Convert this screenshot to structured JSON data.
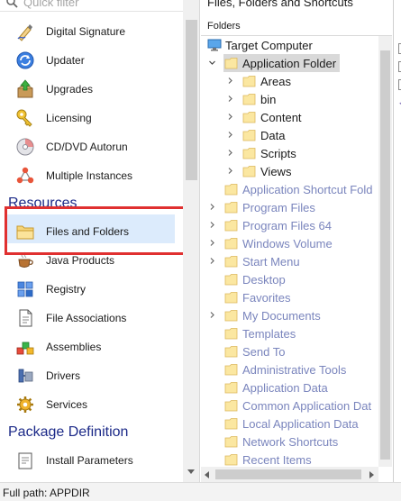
{
  "filter": {
    "placeholder": "Quick filter"
  },
  "nav": {
    "group1_items": [
      {
        "label": "Digital Signature",
        "icon": "signature-icon"
      },
      {
        "label": "Updater",
        "icon": "updater-icon"
      },
      {
        "label": "Upgrades",
        "icon": "upgrades-icon"
      },
      {
        "label": "Licensing",
        "icon": "key-icon"
      },
      {
        "label": "CD/DVD Autorun",
        "icon": "disc-icon"
      },
      {
        "label": "Multiple Instances",
        "icon": "instances-icon"
      }
    ],
    "resources_header": "Resources",
    "resources_items": [
      {
        "label": "Files and Folders",
        "icon": "folder-icon",
        "selected": true
      },
      {
        "label": "Java Products",
        "icon": "java-icon"
      },
      {
        "label": "Registry",
        "icon": "registry-icon"
      },
      {
        "label": "File Associations",
        "icon": "file-association-icon"
      },
      {
        "label": "Assemblies",
        "icon": "assemblies-icon"
      },
      {
        "label": "Drivers",
        "icon": "drivers-icon"
      },
      {
        "label": "Services",
        "icon": "services-icon"
      }
    ],
    "package_header": "Package Definition",
    "package_items": [
      {
        "label": "Install Parameters",
        "icon": "install-parameters-icon"
      }
    ]
  },
  "center": {
    "title": "Files, Folders and Shortcuts",
    "tree_header": "Folders",
    "tree": [
      {
        "label": "Target Computer",
        "icon": "computer",
        "expander": "none",
        "depth": 0,
        "dim": false
      },
      {
        "label": "Application Folder",
        "icon": "folder",
        "expander": "open",
        "depth": 1,
        "dim": false,
        "selected": true
      },
      {
        "label": "Areas",
        "icon": "folder",
        "expander": "closed",
        "depth": 2,
        "dim": false
      },
      {
        "label": "bin",
        "icon": "folder",
        "expander": "closed",
        "depth": 2,
        "dim": false
      },
      {
        "label": "Content",
        "icon": "folder",
        "expander": "closed",
        "depth": 2,
        "dim": false
      },
      {
        "label": "Data",
        "icon": "folder",
        "expander": "closed",
        "depth": 2,
        "dim": false
      },
      {
        "label": "Scripts",
        "icon": "folder",
        "expander": "closed",
        "depth": 2,
        "dim": false
      },
      {
        "label": "Views",
        "icon": "folder",
        "expander": "closed",
        "depth": 2,
        "dim": false
      },
      {
        "label": "Application Shortcut Fold",
        "icon": "folder",
        "expander": "none",
        "depth": 1,
        "dim": true
      },
      {
        "label": "Program Files",
        "icon": "folder",
        "expander": "closed",
        "depth": 1,
        "dim": true
      },
      {
        "label": "Program Files 64",
        "icon": "folder",
        "expander": "closed",
        "depth": 1,
        "dim": true
      },
      {
        "label": "Windows Volume",
        "icon": "folder",
        "expander": "closed",
        "depth": 1,
        "dim": true
      },
      {
        "label": "Start Menu",
        "icon": "folder",
        "expander": "closed",
        "depth": 1,
        "dim": true
      },
      {
        "label": "Desktop",
        "icon": "folder",
        "expander": "none",
        "depth": 1,
        "dim": true
      },
      {
        "label": "Favorites",
        "icon": "folder",
        "expander": "none",
        "depth": 1,
        "dim": true
      },
      {
        "label": "My Documents",
        "icon": "folder",
        "expander": "closed",
        "depth": 1,
        "dim": true
      },
      {
        "label": "Templates",
        "icon": "folder",
        "expander": "none",
        "depth": 1,
        "dim": true
      },
      {
        "label": "Send To",
        "icon": "folder",
        "expander": "none",
        "depth": 1,
        "dim": true
      },
      {
        "label": "Administrative Tools",
        "icon": "folder",
        "expander": "none",
        "depth": 1,
        "dim": true
      },
      {
        "label": "Application Data",
        "icon": "folder",
        "expander": "none",
        "depth": 1,
        "dim": true
      },
      {
        "label": "Common Application Dat",
        "icon": "folder",
        "expander": "none",
        "depth": 1,
        "dim": true
      },
      {
        "label": "Local Application Data",
        "icon": "folder",
        "expander": "none",
        "depth": 1,
        "dim": true
      },
      {
        "label": "Network Shortcuts",
        "icon": "folder",
        "expander": "none",
        "depth": 1,
        "dim": true
      },
      {
        "label": "Recent Items",
        "icon": "folder",
        "expander": "none",
        "depth": 1,
        "dim": true
      }
    ]
  },
  "status": {
    "text": "Full path: APPDIR"
  },
  "colors": {
    "section_header": "#1c2a88",
    "selection_bg": "#dcebfc",
    "highlight_border": "#e03030",
    "dim_text": "#7a85bd",
    "folder_fill": "#fbe7a1",
    "folder_stroke": "#dcb85c"
  }
}
